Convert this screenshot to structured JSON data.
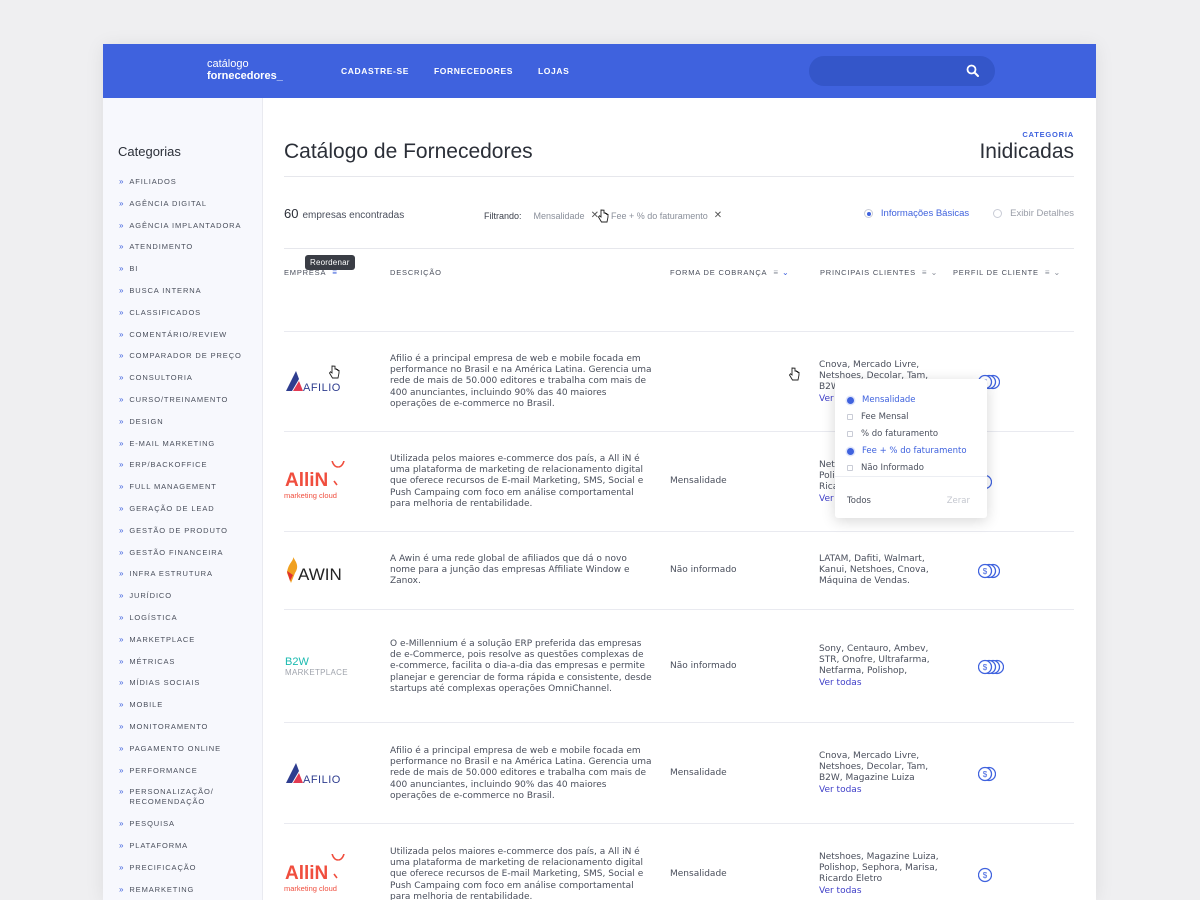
{
  "header": {
    "logo_line1": "catálogo",
    "logo_line2": "fornecedores_",
    "nav": [
      "CADASTRE-SE",
      "FORNECEDORES",
      "LOJAS"
    ],
    "search_placeholder": ""
  },
  "sidebar": {
    "title": "Categorias",
    "items": [
      "AFILIADOS",
      "AGÊNCIA DIGITAL",
      "AGÊNCIA IMPLANTADORA",
      "ATENDIMENTO",
      "BI",
      "BUSCA INTERNA",
      "CLASSIFICADOS",
      "COMENTÁRIO/REVIEW",
      "COMPARADOR DE PREÇO",
      "CONSULTORIA",
      "CURSO/TREINAMENTO",
      "DESIGN",
      "E-MAIL MARKETING",
      "ERP/BACKOFFICE",
      "FULL MANAGEMENT",
      "GERAÇÃO DE LEAD",
      "GESTÃO DE PRODUTO",
      "GESTÃO FINANCEIRA",
      "INFRA ESTRUTURA",
      "JURÍDICO",
      "LOGÍSTICA",
      "MARKETPLACE",
      "MÉTRICAS",
      "MÍDIAS SOCIAIS",
      "MOBILE",
      "MONITORAMENTO",
      "PAGAMENTO ONLINE",
      "PERFORMANCE",
      "PERSONALIZAÇÃO/ RECOMENDAÇÃO",
      "PESQUISA",
      "PLATAFORMA",
      "PRECIFICAÇÃO",
      "REMARKETING"
    ]
  },
  "page": {
    "title": "Catálogo de Fornecedores",
    "category_label": "CATEGORIA",
    "category_value": "Inidicadas",
    "count": "60",
    "count_label": "empresas encontradas",
    "filter_label": "Filtrando:",
    "filters": [
      "Mensalidade",
      "Fee + % do faturamento"
    ],
    "view_basic": "Informações Básicas",
    "view_details": "Exibir Detalhes"
  },
  "table": {
    "tooltip": "Reordenar",
    "headers": {
      "empresa": "EMPRESA",
      "descricao": "DESCRIÇÃO",
      "forma": "FORMA DE COBRANÇA",
      "clientes": "PRINCIPAIS CLIENTES",
      "perfil": "PERFIL DE CLIENTE"
    },
    "rows": [
      {
        "logo": "AFILIO",
        "desc": "Afilio é a principal empresa de web e mobile focada em performance no Brasil e na América Latina. Gerencia uma rede de mais de 50.000 editores e trabalha com mais de 400 anunciantes, incluindo 90% das 40 maiores operações de e-commerce no Brasil.",
        "forma": "",
        "clientes": "Cnova, Mercado Livre, Netshoes, Decolar, Tam, B2W, Magazine Luiza",
        "ver": "Ver todas",
        "perfil": 3
      },
      {
        "logo": "AlliN",
        "logo_sub": "marketing cloud",
        "desc": "Utilizada pelos maiores e-commerce dos país, a All iN é uma plataforma de marketing de relacionamento digital que oferece recursos de E-mail Marketing, SMS, Social e Push Campaing com foco em análise comportamental para melhoria de rentabilidade.",
        "forma": "Mensalidade",
        "clientes": "Netshoes, Magazine Luiza, Polishop, Sephora, Marisa, Ricardo Eletro",
        "ver": "Ver todas",
        "perfil": 1
      },
      {
        "logo": "AWIN",
        "desc": "A Awin é uma rede global de afiliados que dá o novo nome para a junção das empresas Affiliate Window e Zanox.",
        "forma": "Não informado",
        "clientes": "LATAM, Dafiti, Walmart, Kanui, Netshoes, Cnova, Máquina de Vendas.",
        "ver": "",
        "perfil": 3
      },
      {
        "logo": "B2W",
        "logo_sub": "MARKETPLACE",
        "desc": "O e-Millennium é a solução ERP preferida das empresas de e-Commerce, pois resolve as questões complexas de e-commerce, facilita o dia-a-dia das empresas e permite planejar e gerenciar de forma rápida e consistente, desde startups até complexas operações OmniChannel.",
        "forma": "Não informado",
        "clientes": "Sony, Centauro, Ambev, STR, Onofre, Ultrafarma, Netfarma, Polishop,",
        "ver": "Ver todas",
        "perfil": 4
      },
      {
        "logo": "AFILIO",
        "desc": "Afilio é a principal empresa de web e mobile focada em performance no Brasil e na América Latina. Gerencia uma rede de mais de 50.000 editores e trabalha com mais de 400 anunciantes, incluindo 90% das 40 maiores operações de e-commerce no Brasil.",
        "forma": "Mensalidade",
        "clientes": "Cnova, Mercado Livre, Netshoes, Decolar, Tam, B2W, Magazine Luiza",
        "ver": "Ver todas",
        "perfil": 2
      },
      {
        "logo": "AlliN",
        "logo_sub": "marketing cloud",
        "desc": "Utilizada pelos maiores e-commerce dos país, a All iN é uma plataforma de marketing de relacionamento digital que oferece recursos de E-mail Marketing, SMS, Social e Push Campaing com foco em análise comportamental para melhoria de rentabilidade.",
        "forma": "Mensalidade",
        "clientes": "Netshoes, Magazine Luiza, Polishop, Sephora, Marisa, Ricardo Eletro",
        "ver": "Ver todas",
        "perfil": 1
      }
    ]
  },
  "dropdown": {
    "options": [
      {
        "label": "Mensalidade",
        "checked": true
      },
      {
        "label": "Fee Mensal",
        "checked": false
      },
      {
        "label": "% do faturamento",
        "checked": false
      },
      {
        "label": "Fee + % do faturamento",
        "checked": true
      },
      {
        "label": "Não Informado",
        "checked": false
      }
    ],
    "todos": "Todos",
    "zerar": "Zerar"
  },
  "colors": {
    "accent": "#3f62de",
    "link": "#3f3fc8",
    "allin": "#f04e3e"
  },
  "icons": [
    "search-icon",
    "sort-icon",
    "chevron-down-icon",
    "close-icon",
    "coin-stack-icon",
    "cursor-hand-icon"
  ]
}
